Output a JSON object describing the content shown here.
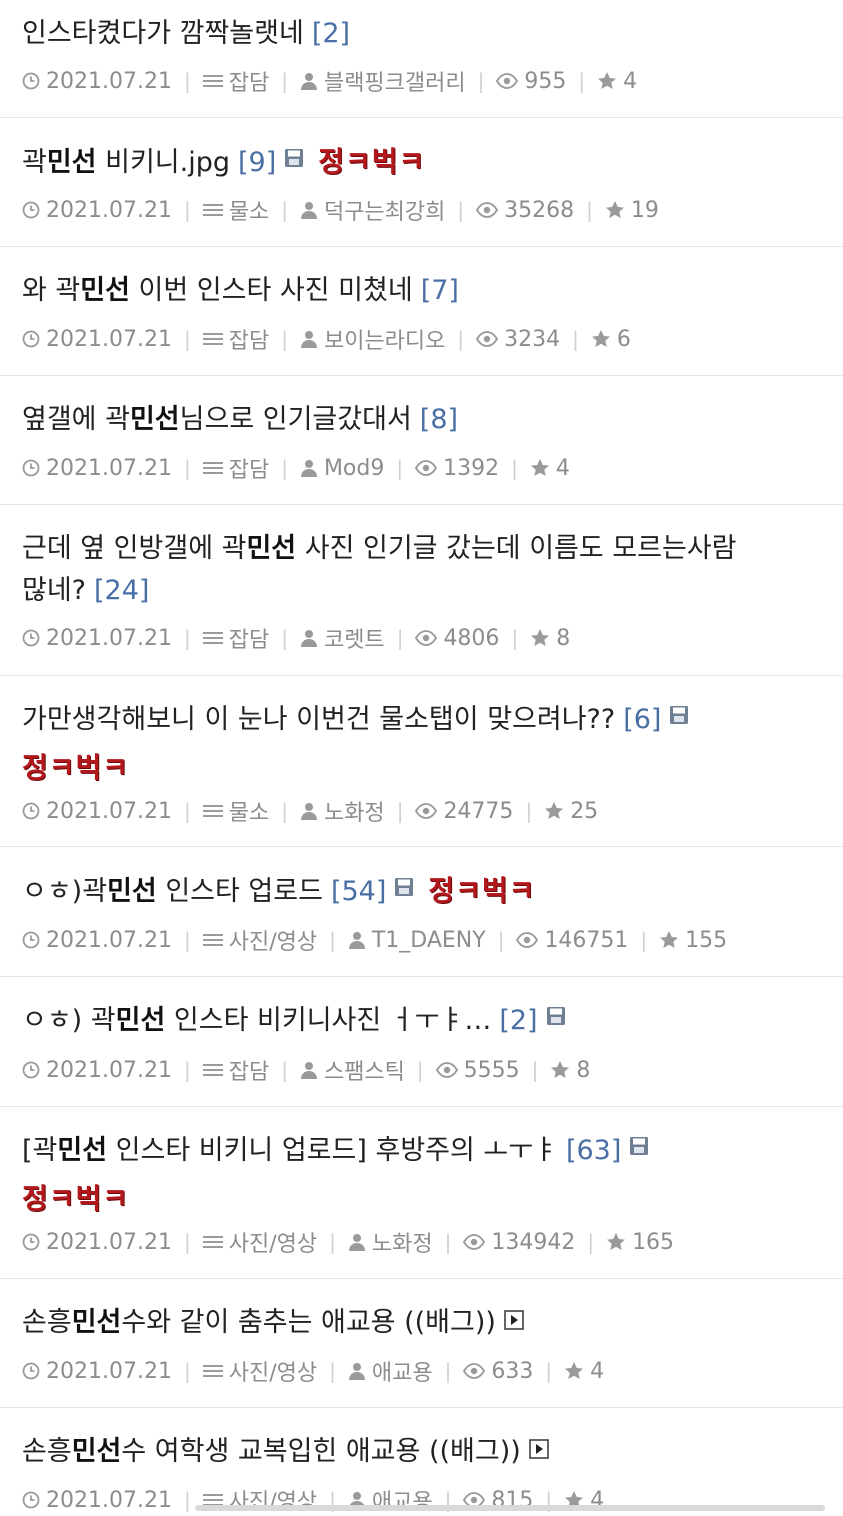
{
  "posts": [
    {
      "title_parts": [
        "인스타켰다가 깜짝놀랫네"
      ],
      "highlight": "",
      "comments": "[2]",
      "has_file": false,
      "has_video": false,
      "badge": "",
      "date": "2021.07.21",
      "category": "잡담",
      "author": "블랙핑크갤러리",
      "views": "955",
      "likes": "4"
    },
    {
      "title_parts": [
        "곽",
        "민선",
        " 비키니.jpg"
      ],
      "comments": "[9]",
      "has_file": true,
      "has_video": false,
      "badge": "정ㅋ벅ㅋ",
      "date": "2021.07.21",
      "category": "물소",
      "author": "덕구는최강희",
      "views": "35268",
      "likes": "19"
    },
    {
      "title_parts": [
        "와 곽",
        "민선",
        " 이번 인스타 사진 미쳤네"
      ],
      "comments": "[7]",
      "has_file": false,
      "has_video": false,
      "badge": "",
      "date": "2021.07.21",
      "category": "잡담",
      "author": "보이는라디오",
      "views": "3234",
      "likes": "6"
    },
    {
      "title_parts": [
        "옆갤에 곽",
        "민선",
        "님으로 인기글갔대서"
      ],
      "comments": "[8]",
      "has_file": false,
      "has_video": false,
      "badge": "",
      "date": "2021.07.21",
      "category": "잡담",
      "author": "Mod9",
      "views": "1392",
      "likes": "4"
    },
    {
      "title_parts": [
        "근데 옆 인방갤에 곽",
        "민선",
        " 사진 인기글 갔는데 이름도 모르는사람"
      ],
      "title_line2": "많네?",
      "comments": "[24]",
      "has_file": false,
      "has_video": false,
      "badge": "",
      "date": "2021.07.21",
      "category": "잡담",
      "author": "코렛트",
      "views": "4806",
      "likes": "8"
    },
    {
      "title_parts": [
        "가만생각해보니 이 눈나 이번건 물소탭이 맞으려나??"
      ],
      "comments": "[6]",
      "has_file": true,
      "has_video": false,
      "badge": "정ㅋ벅ㅋ",
      "date": "2021.07.21",
      "category": "물소",
      "author": "노화정",
      "views": "24775",
      "likes": "25"
    },
    {
      "title_parts": [
        "ㅇㅎ)곽",
        "민선",
        " 인스타 업로드"
      ],
      "comments": "[54]",
      "has_file": true,
      "has_video": false,
      "badge": "정ㅋ벅ㅋ",
      "date": "2021.07.21",
      "category": "사진/영상",
      "author": "T1_DAENY",
      "views": "146751",
      "likes": "155"
    },
    {
      "title_parts": [
        "ㅇㅎ) 곽",
        "민선",
        " 인스타 비키니사진 ㅓㅜㅑ…"
      ],
      "comments": "[2]",
      "has_file": true,
      "has_video": false,
      "badge": "",
      "date": "2021.07.21",
      "category": "잡담",
      "author": "스팸스틱",
      "views": "5555",
      "likes": "8"
    },
    {
      "title_parts": [
        "[곽",
        "민선",
        " 인스타 비키니 업로드] 후방주의 ㅗㅜㅑ"
      ],
      "comments": "[63]",
      "has_file": true,
      "has_video": false,
      "badge": "정ㅋ벅ㅋ",
      "date": "2021.07.21",
      "category": "사진/영상",
      "author": "노화정",
      "views": "134942",
      "likes": "165"
    },
    {
      "title_parts": [
        "손흥",
        "민선",
        "수와 같이 춤추는 애교용 ((배그))"
      ],
      "comments": "",
      "has_file": false,
      "has_video": true,
      "badge": "",
      "date": "2021.07.21",
      "category": "사진/영상",
      "author": "애교용",
      "views": "633",
      "likes": "4"
    },
    {
      "title_parts": [
        "손흥",
        "민선",
        "수 여학생 교복입힌 애교용 ((배그))"
      ],
      "comments": "",
      "has_file": false,
      "has_video": true,
      "badge": "",
      "date": "2021.07.21",
      "category": "사진/영상",
      "author": "애교용",
      "views": "815",
      "likes": "4"
    }
  ]
}
